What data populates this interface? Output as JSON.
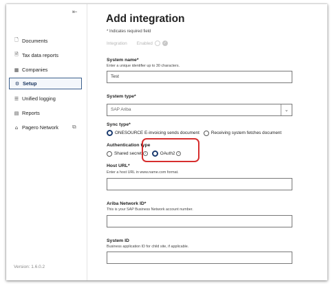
{
  "sidebar": {
    "collapse_icon": "collapse-arrow",
    "items": [
      {
        "label": "Documents",
        "icon": "document-icon",
        "glyph": "🗋",
        "active": false
      },
      {
        "label": "Tax data reports",
        "icon": "report-icon",
        "glyph": "🗎",
        "active": false
      },
      {
        "label": "Companies",
        "icon": "building-icon",
        "glyph": "▦",
        "active": false
      },
      {
        "label": "Setup",
        "icon": "gear-icon",
        "glyph": "⚙",
        "active": true
      },
      {
        "label": "Unified logging",
        "icon": "log-icon",
        "glyph": "☰",
        "active": false
      },
      {
        "label": "Reports",
        "icon": "reports-icon",
        "glyph": "▤",
        "active": false
      },
      {
        "label": "Pagero Network",
        "icon": "network-icon",
        "glyph": "⌂",
        "active": false
      }
    ],
    "version": "Version: 1.6.0.2"
  },
  "main": {
    "title": "Add integration",
    "required_note": "* Indicates required field",
    "toggle": {
      "label": "Integration",
      "state_label": "Enabled"
    },
    "system_name": {
      "label": "System name*",
      "help": "Enter a unique identifier up to 30 characters.",
      "value": "Test"
    },
    "system_type": {
      "label": "System type*",
      "value": "SAP Ariba"
    },
    "sync_type": {
      "label": "Sync type*",
      "options": [
        "ONESOURCE E-invoicing sends document",
        "Receiving system fetches document"
      ],
      "selected": 0
    },
    "auth_type": {
      "label": "Authentication type",
      "options": [
        "Shared secret",
        "OAuth2"
      ],
      "selected": 1
    },
    "host_url": {
      "label": "Host URL*",
      "help": "Enter a host URL in www.name.com format.",
      "value": ""
    },
    "ariba_network_id": {
      "label": "Ariba Network ID*",
      "help": "This is your SAP Business Network account number.",
      "value": ""
    },
    "system_id": {
      "label": "System ID",
      "help": "Business application ID for child site, if applicable.",
      "value": ""
    }
  },
  "colors": {
    "accent": "#1a3a6e",
    "highlight": "#d62d2d",
    "active_border": "#3b5e8c"
  }
}
